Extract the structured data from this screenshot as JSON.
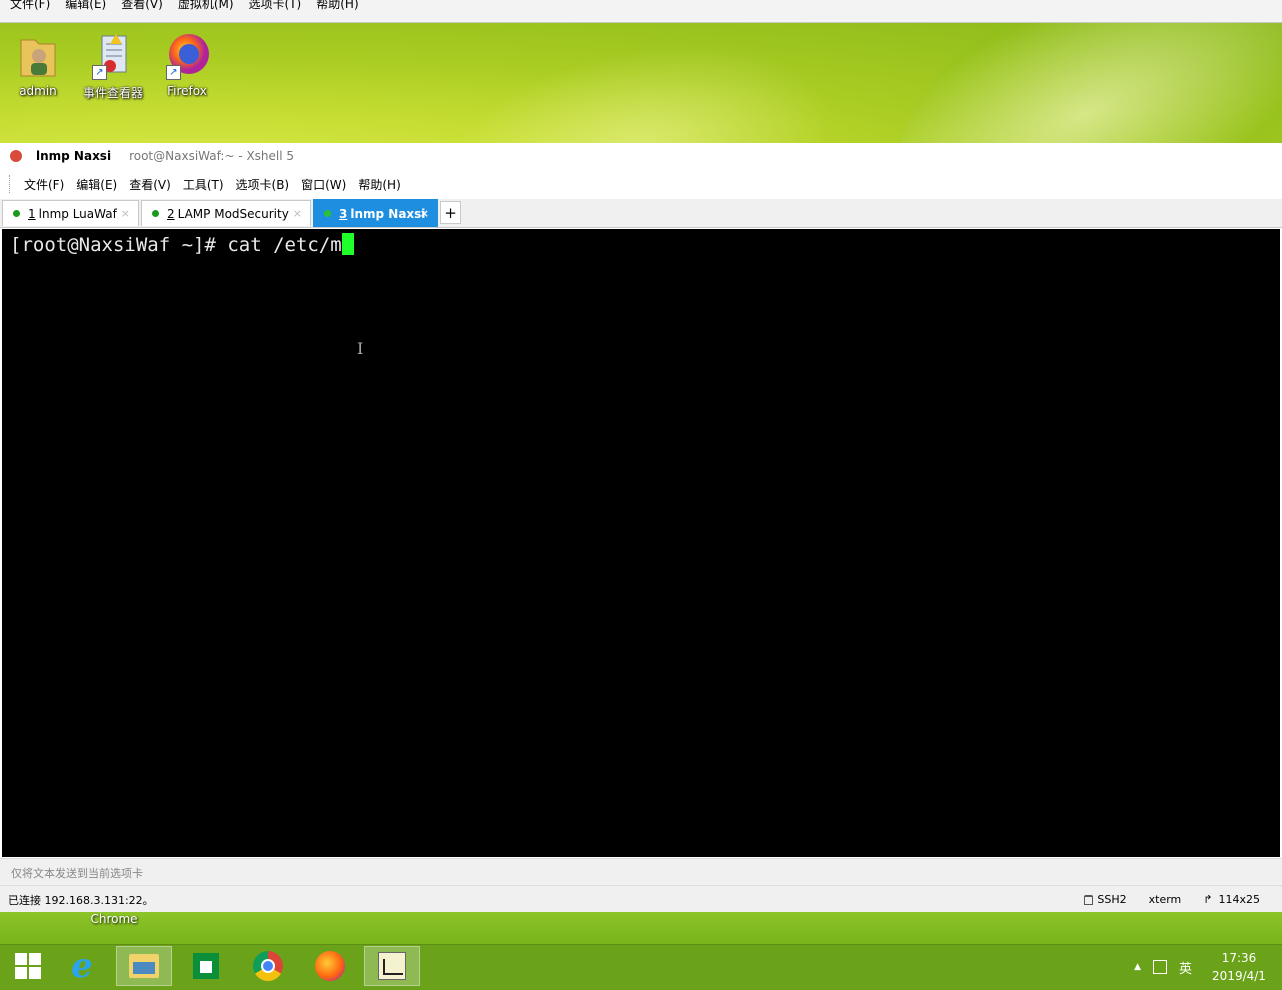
{
  "vm_menu": [
    "文件(F)",
    "编辑(E)",
    "查看(V)",
    "虚拟机(M)",
    "选项卡(T)",
    "帮助(H)"
  ],
  "desktop_icons": [
    {
      "label": "admin",
      "icon": "user-folder-icon"
    },
    {
      "label": "事件查看器",
      "icon": "event-viewer-icon"
    },
    {
      "label": "Firefox",
      "icon": "firefox-icon"
    }
  ],
  "xshell": {
    "title": "lnmp Naxsi",
    "subtitle": "root@NaxsiWaf:~ - Xshell 5",
    "menu": [
      "文件(F)",
      "编辑(E)",
      "查看(V)",
      "工具(T)",
      "选项卡(B)",
      "窗口(W)",
      "帮助(H)"
    ],
    "tabs": [
      {
        "num": "1",
        "label": "lnmp LuaWaf",
        "active": false
      },
      {
        "num": "2",
        "label": "LAMP ModSecurity",
        "active": false
      },
      {
        "num": "3",
        "label": "lnmp Naxsi",
        "active": true
      }
    ],
    "tab_add": "+",
    "terminal_line": "[root@NaxsiWaf ~]# cat /etc/m",
    "send_hint": "仅将文本发送到当前选项卡",
    "status": {
      "connection": "已连接 192.168.3.131:22。",
      "protocol": "SSH2",
      "term": "xterm",
      "size": "114x25"
    }
  },
  "desktop_partial_label": "Chrome",
  "taskbar": {
    "apps": [
      "windows-start-icon",
      "internet-explorer-icon",
      "file-explorer-icon",
      "windows-store-icon",
      "chrome-icon",
      "firefox-icon",
      "xshell-icon"
    ],
    "ime": "英",
    "time": "17:36",
    "date": "2019/4/1"
  }
}
